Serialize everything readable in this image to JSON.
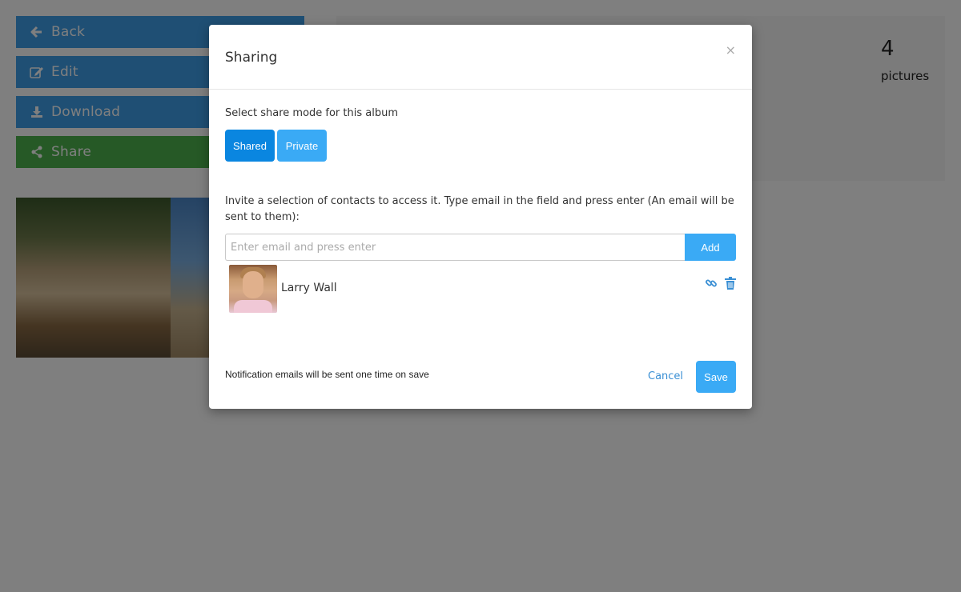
{
  "sidebar": {
    "back_label": "Back",
    "edit_label": "Edit",
    "download_label": "Download",
    "share_label": "Share"
  },
  "stats": {
    "pictures_count": "4",
    "pictures_label": "pictures"
  },
  "modal": {
    "title": "Sharing",
    "close_symbol": "×",
    "mode_label": "Select share mode for this album",
    "mode_options": {
      "shared": "Shared",
      "private": "Private"
    },
    "selected_mode": "Shared",
    "invite_text": "Invite a selection of contacts to access it. Type email in the field and press enter (An email will be sent to them):",
    "email_input": {
      "placeholder": "Enter email and press enter",
      "value": ""
    },
    "add_label": "Add",
    "contacts": [
      {
        "name": "Larry Wall"
      }
    ],
    "footer_note": "Notification emails will be sent one time on save",
    "cancel_label": "Cancel",
    "save_label": "Save"
  },
  "colors": {
    "primary": "#3aaaf5",
    "primary_active": "#0a86e0",
    "sidebar_blue": "#3f9ee8",
    "share_green": "#4cb34c",
    "link": "#3a8fd4"
  }
}
